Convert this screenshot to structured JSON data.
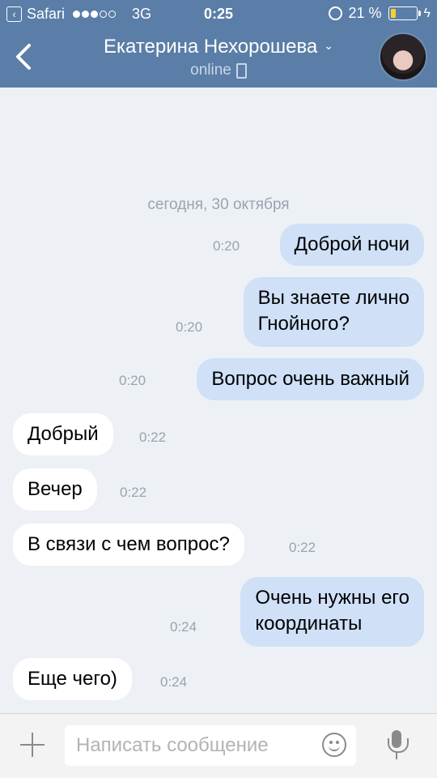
{
  "status_bar": {
    "carrier": "Safari",
    "network": "3G",
    "time": "0:25",
    "battery": "21 %",
    "battery_level": 0.21
  },
  "header": {
    "contact_name": "Екатерина Нехорошева",
    "status": "online"
  },
  "chat": {
    "date_separator": "сегодня, 30 октября",
    "messages": [
      {
        "direction": "out",
        "text": "Доброй ночи",
        "time": "0:20"
      },
      {
        "direction": "out",
        "text": "Вы знаете лично\nГнойного?",
        "time": "0:20"
      },
      {
        "direction": "out",
        "text": "Вопрос очень важный",
        "time": "0:20"
      },
      {
        "direction": "in",
        "text": "Добрый",
        "time": "0:22"
      },
      {
        "direction": "in",
        "text": "Вечер",
        "time": "0:22"
      },
      {
        "direction": "in",
        "text": "В связи с чем вопрос?",
        "time": "0:22"
      },
      {
        "direction": "out",
        "text": "Очень нужны его\nкоординаты",
        "time": "0:24"
      },
      {
        "direction": "in",
        "text": "Еще чего)",
        "time": "0:24"
      }
    ]
  },
  "composer": {
    "placeholder": "Написать сообщение"
  }
}
